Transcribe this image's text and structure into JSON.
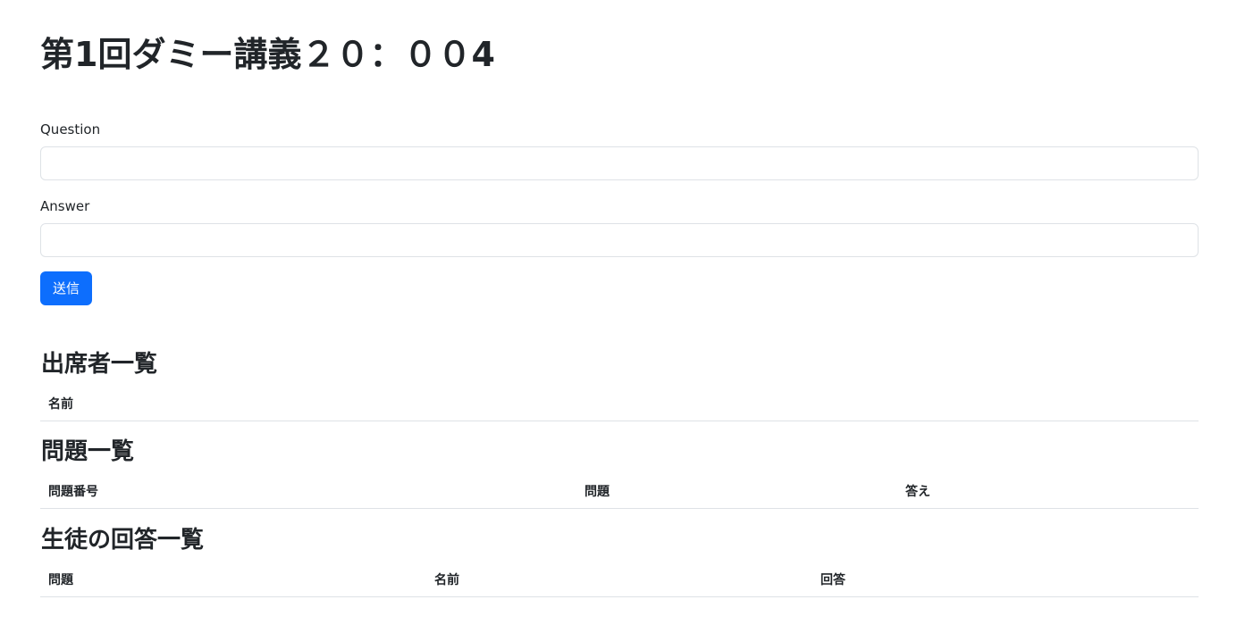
{
  "page": {
    "title": "第1回ダミー講義２０：００4"
  },
  "form": {
    "question_label": "Question",
    "question_value": "",
    "answer_label": "Answer",
    "answer_value": "",
    "submit_label": "送信"
  },
  "attendees": {
    "heading": "出席者一覧",
    "columns": [
      "名前"
    ]
  },
  "questions": {
    "heading": "問題一覧",
    "columns": [
      "問題番号",
      "問題",
      "答え"
    ]
  },
  "student_answers": {
    "heading": "生徒の回答一覧",
    "columns": [
      "問題",
      "名前",
      "回答"
    ]
  },
  "colors": {
    "primary": "#0d6efd",
    "text": "#212529",
    "border": "#dee2e6"
  }
}
